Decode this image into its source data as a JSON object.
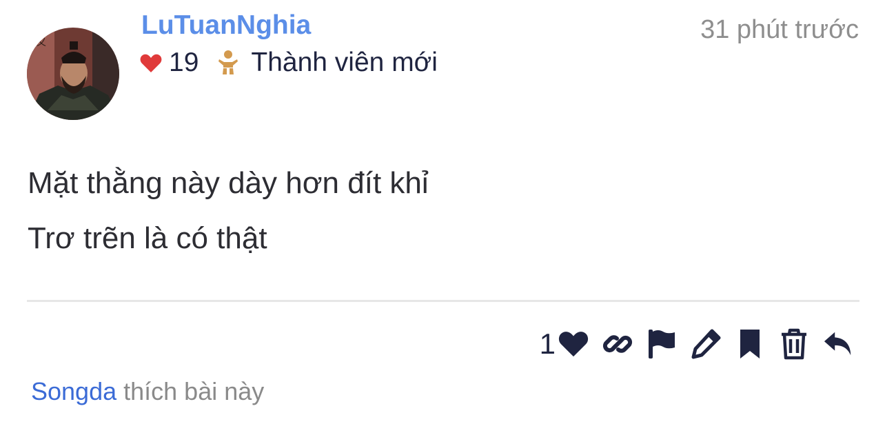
{
  "post": {
    "author": "LuTuanNghia",
    "time": "31 phút trước",
    "reputation": "19",
    "rank": "Thành viên mới",
    "lines": [
      "Mặt thằng này dày hơn đít khỉ",
      "Trơ trẽn là có thật"
    ]
  },
  "actions": {
    "like_count": "1",
    "icons": [
      "heart-icon",
      "link-icon",
      "flag-icon",
      "pencil-icon",
      "bookmark-icon",
      "trash-icon",
      "reply-icon"
    ]
  },
  "likes": {
    "user": "Songda",
    "text": "thích bài này"
  },
  "colors": {
    "username": "#5b8ee8",
    "heart": "#e03a3a",
    "rank_icon": "#d39a4e",
    "icon_dark": "#1f2440",
    "muted": "#8e8e8e",
    "link": "#3b6bd6"
  }
}
